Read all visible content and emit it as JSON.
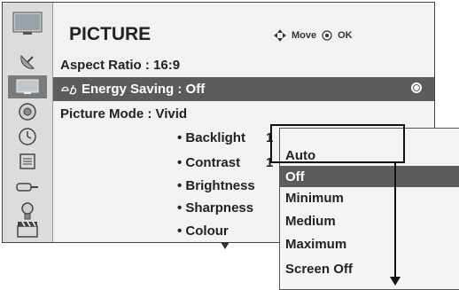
{
  "header": {
    "title": "PICTURE",
    "move_label": "Move",
    "ok_label": "OK"
  },
  "sidebar": {
    "items": [
      {
        "icon": "tv-icon"
      },
      {
        "icon": "satellite-dish-icon"
      },
      {
        "icon": "picture-icon"
      },
      {
        "icon": "speaker-icon"
      },
      {
        "icon": "clock-icon"
      },
      {
        "icon": "option-box-icon"
      },
      {
        "icon": "lock-icon"
      },
      {
        "icon": "usb-icon"
      },
      {
        "icon": "clapperboard-icon"
      }
    ]
  },
  "menu": {
    "aspect_ratio": "Aspect Ratio   : 16:9",
    "energy_saving": "Energy Saving    : Off",
    "picture_mode": "Picture Mode  : Vivid",
    "sub_items": [
      {
        "label": "• Backlight",
        "value": "1"
      },
      {
        "label": "• Contrast",
        "value": "1"
      },
      {
        "label": "• Brightness",
        "value": ""
      },
      {
        "label": "• Sharpness",
        "value": ""
      },
      {
        "label": "• Colour",
        "value": ""
      }
    ]
  },
  "energy_options": {
    "items": [
      "Auto",
      "Off",
      "Minimum",
      "Medium",
      "Maximum",
      "Screen Off"
    ],
    "selected": "Off"
  }
}
